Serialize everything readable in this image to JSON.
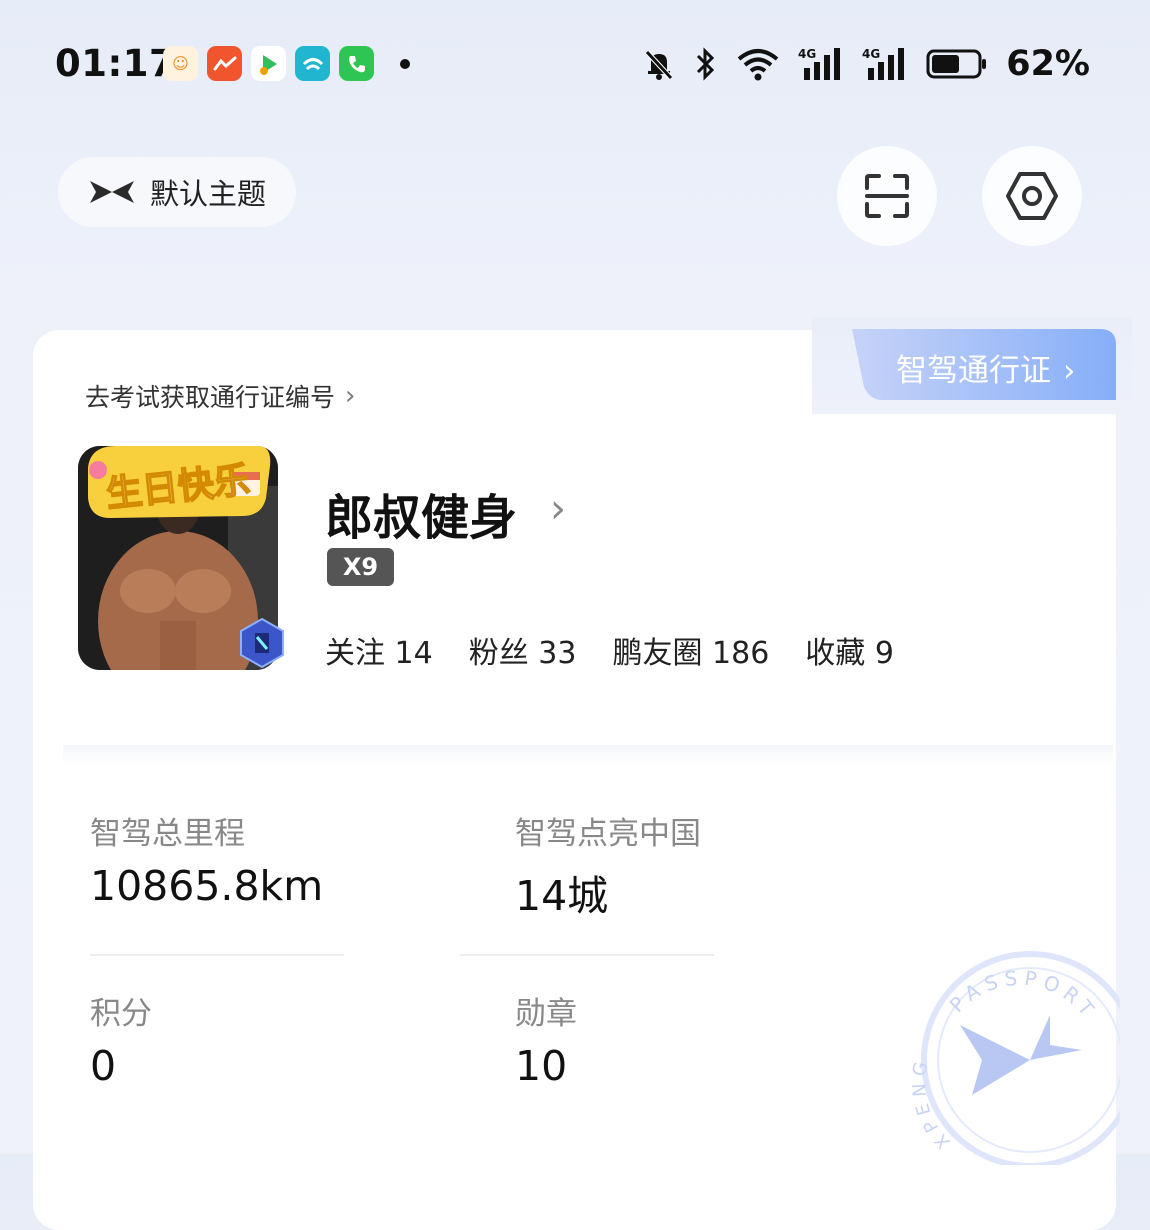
{
  "status_bar": {
    "time": "01:17",
    "battery_percent": "62%",
    "battery_level": 0.62,
    "network_1": "4G",
    "network_2": "4G",
    "icons": [
      "mute-bell-icon",
      "bluetooth-icon",
      "wifi-icon",
      "signal-icon",
      "signal-icon",
      "battery-icon"
    ]
  },
  "header": {
    "theme_label": "默认主题",
    "scan_icon": "scan-icon",
    "settings_icon": "hex-settings-icon"
  },
  "passport": {
    "tab_label": "智驾通行证",
    "exam_link": "去考试获取通行证编号"
  },
  "profile": {
    "name": "郎叔健身",
    "model": "X9",
    "avatar_banner": "生日快乐",
    "stats": [
      {
        "label": "关注",
        "value": "14"
      },
      {
        "label": "粉丝",
        "value": "33"
      },
      {
        "label": "鹏友圈",
        "value": "186"
      },
      {
        "label": "收藏",
        "value": "9"
      }
    ]
  },
  "metrics": [
    {
      "label": "智驾总里程",
      "value": "10865.8km"
    },
    {
      "label": "智驾点亮中国",
      "value": "14城"
    },
    {
      "label": "积分",
      "value": "0"
    },
    {
      "label": "勋章",
      "value": "10"
    }
  ],
  "stamp": {
    "text": "PASSPORT",
    "subtext": "XPENG"
  },
  "colors": {
    "accent_blue": "#7fa3f0",
    "tab_gradient_start": "#b9c9f5",
    "tab_gradient_end": "#8ab0f7"
  }
}
